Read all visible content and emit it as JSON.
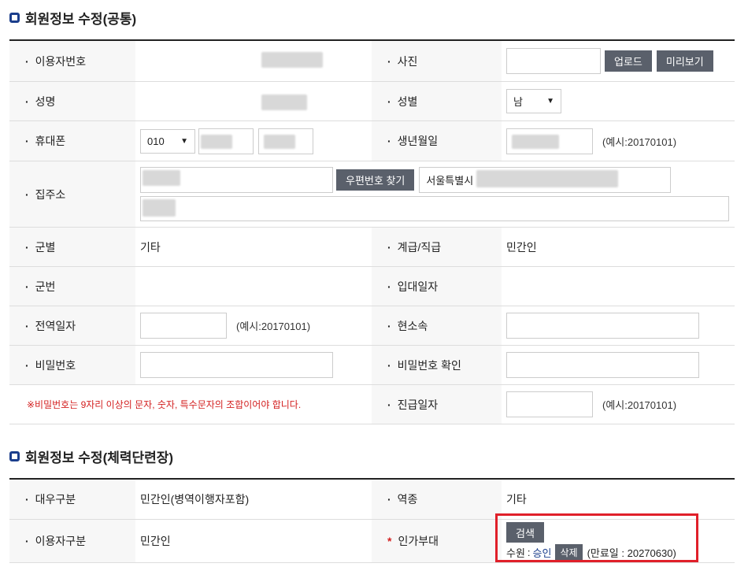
{
  "section1": {
    "title": "회원정보 수정(공통)",
    "labels": {
      "user_no": "이용자번호",
      "photo": "사진",
      "name": "성명",
      "gender": "성별",
      "phone": "휴대폰",
      "birth": "생년월일",
      "address": "집주소",
      "branch": "군별",
      "rank": "계급/직급",
      "service_no": "군번",
      "enlist_date": "입대일자",
      "discharge_date": "전역일자",
      "unit": "현소속",
      "password": "비밀번호",
      "password_confirm": "비밀번호 확인",
      "promotion_date": "진급일자"
    },
    "upload_label": "업로드",
    "preview_label": "미리보기",
    "gender_value": "남",
    "phone_prefix": "010",
    "example_date": "(예시:20170101)",
    "zip_button": "우편번호 찾기",
    "address_city": "서울특별시",
    "branch_value": "기타",
    "rank_value": "민간인",
    "password_warning": "※비밀번호는 9자리 이상의 문자, 숫자, 특수문자의 조합이어야 합니다."
  },
  "section2": {
    "title": "회원정보 수정(체력단련장)",
    "labels": {
      "treatment": "대우구분",
      "service_type": "역종",
      "user_type": "이용자구분",
      "approved_unit": "인가부대"
    },
    "treatment_value": "민간인(병역이행자포함)",
    "service_type_value": "기타",
    "user_type_value": "민간인",
    "search_button": "검색",
    "unit_name": "수원",
    "unit_separator": ":",
    "approval_status": "승인",
    "delete_button": "삭제",
    "expiry": "(만료일 : 20270630)"
  },
  "colors": {
    "accent": "#1b3e8c",
    "button": "#5a606b",
    "warning": "#d32020",
    "highlight": "#e0202a"
  }
}
